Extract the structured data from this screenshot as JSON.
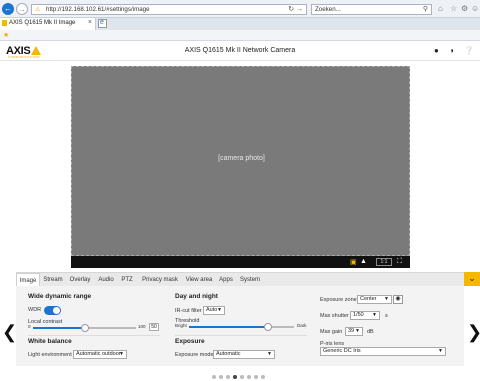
{
  "browser": {
    "url": "http://192.168.102.61/#settings/image",
    "search_placeholder": "Zoeken...",
    "tab_title": "AXIS Q1615 Mk II Image"
  },
  "header": {
    "logo_text": "AXIS",
    "logo_sub": "COMMUNICATIONS",
    "title": "AXIS Q1615 Mk II Network Camera"
  },
  "video": {
    "zoom_label": "1:1"
  },
  "tabs": [
    "Image",
    "Stream",
    "Overlay",
    "Audio",
    "PTZ",
    "Privacy mask",
    "View area",
    "Apps",
    "System"
  ],
  "wdr": {
    "heading": "Wide dynamic range",
    "wdr_label": "WDR",
    "local_contrast_label": "Local contrast",
    "min": "0",
    "max": "100",
    "value": "50",
    "value_fraction": 0.5
  },
  "white_balance": {
    "heading": "White balance",
    "light_env_label": "Light environment",
    "light_env_value": "Automatic outdoor"
  },
  "day_night": {
    "heading": "Day and night",
    "ircut_label": "IR-cut filter",
    "ircut_value": "Auto",
    "threshold_label": "Threshold",
    "bright_label": "Bright",
    "dark_label": "Dark",
    "threshold_fraction": 0.75
  },
  "exposure": {
    "heading": "Exposure",
    "mode_label": "Exposure mode",
    "mode_value": "Automatic",
    "zone_label": "Exposure zone",
    "zone_value": "Center",
    "max_shutter_label": "Max shutter",
    "max_shutter_value": "1/50",
    "max_shutter_unit": "s",
    "max_gain_label": "Max gain",
    "max_gain_value": "39",
    "max_gain_unit": "dB",
    "piris_label": "P-iris lens",
    "piris_value": "Generic DC Iris"
  },
  "pagination": {
    "count": 8,
    "active": 3
  }
}
